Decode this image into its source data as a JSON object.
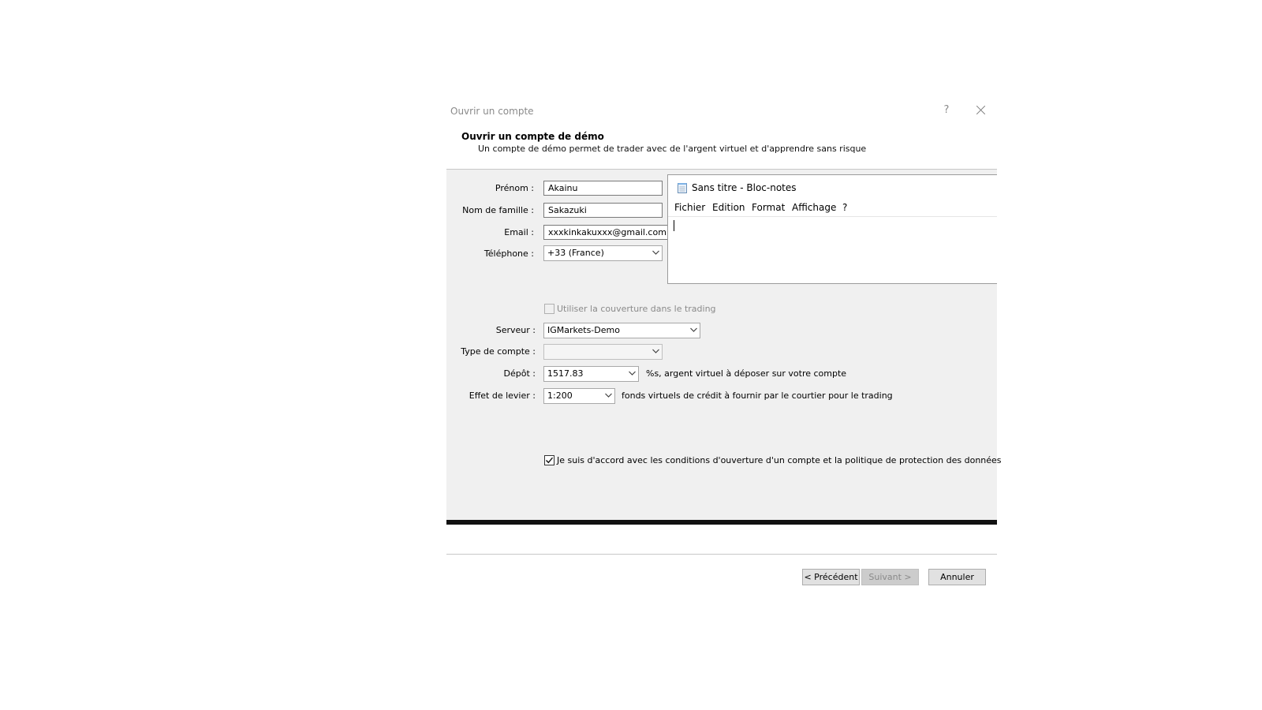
{
  "dialog": {
    "title": "Ouvrir un compte",
    "help": "?",
    "heading": "Ouvrir un compte de démo",
    "subtitle": "Un compte de démo permet de trader avec de l'argent virtuel et d'apprendre sans risque"
  },
  "form": {
    "first_name": {
      "label": "Prénom :",
      "value": "Akainu"
    },
    "last_name": {
      "label": "Nom de famille :",
      "value": "Sakazuki"
    },
    "email": {
      "label": "Email :",
      "value": "xxxkinkakuxxx@gmail.com"
    },
    "phone": {
      "label": "Téléphone :",
      "value": "+33 (France)"
    },
    "hedging": {
      "label": "Utiliser la couverture dans le trading",
      "checked": false,
      "enabled": false
    },
    "server": {
      "label": "Serveur :",
      "value": "IGMarkets-Demo"
    },
    "account_type": {
      "label": "Type de compte :",
      "value": ""
    },
    "deposit": {
      "label": "Dépôt :",
      "value": "1517.83",
      "hint": "%s, argent virtuel à déposer sur votre compte"
    },
    "leverage": {
      "label": "Effet de levier :",
      "value": "1:200",
      "hint": "fonds virtuels de crédit à fournir par le courtier pour le trading"
    },
    "agree": {
      "label": "Je suis d'accord avec les conditions d'ouverture d'un compte et la politique de protection des données",
      "checked": true
    }
  },
  "buttons": {
    "previous": "< Précédent",
    "next": "Suivant >",
    "cancel": "Annuler"
  },
  "notepad": {
    "title": "Sans titre - Bloc-notes",
    "menu": [
      "Fichier",
      "Edition",
      "Format",
      "Affichage",
      "?"
    ]
  }
}
